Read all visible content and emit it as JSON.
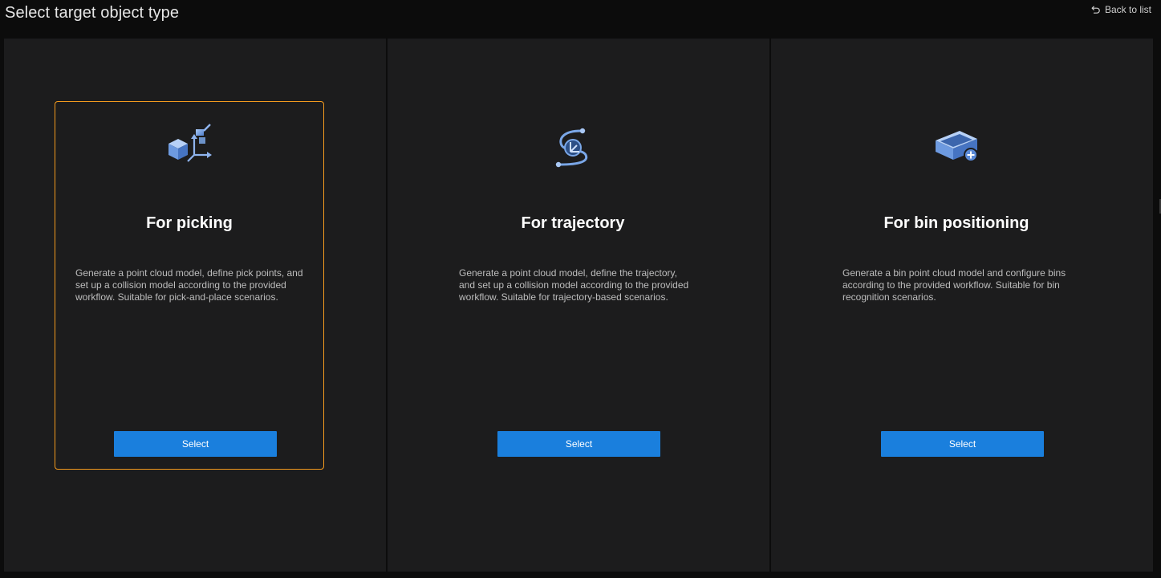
{
  "header": {
    "title": "Select target object type",
    "back_label": "Back to list"
  },
  "cards": [
    {
      "icon": "picking-cube-axes-icon",
      "title": "For picking",
      "description": "Generate a point cloud model, define pick points, and set up a collision model according to the provided workflow. Suitable for pick-and-place scenarios.",
      "button_label": "Select",
      "selected": true
    },
    {
      "icon": "trajectory-path-icon",
      "title": "For trajectory",
      "description": "Generate a point cloud model, define the trajectory, and set up a collision model according to the provided workflow. Suitable for trajectory-based scenarios.",
      "button_label": "Select",
      "selected": false
    },
    {
      "icon": "bin-add-icon",
      "title": "For bin positioning",
      "description": "Generate a bin point cloud model and configure bins according to the provided workflow. Suitable for bin recognition scenarios.",
      "button_label": "Select",
      "selected": false
    }
  ],
  "colors": {
    "accent": "#1a7fdd",
    "selected_border": "#f39a1e",
    "panel_bg": "#1c1c1d",
    "icon_blue": "#7aa7e8"
  }
}
